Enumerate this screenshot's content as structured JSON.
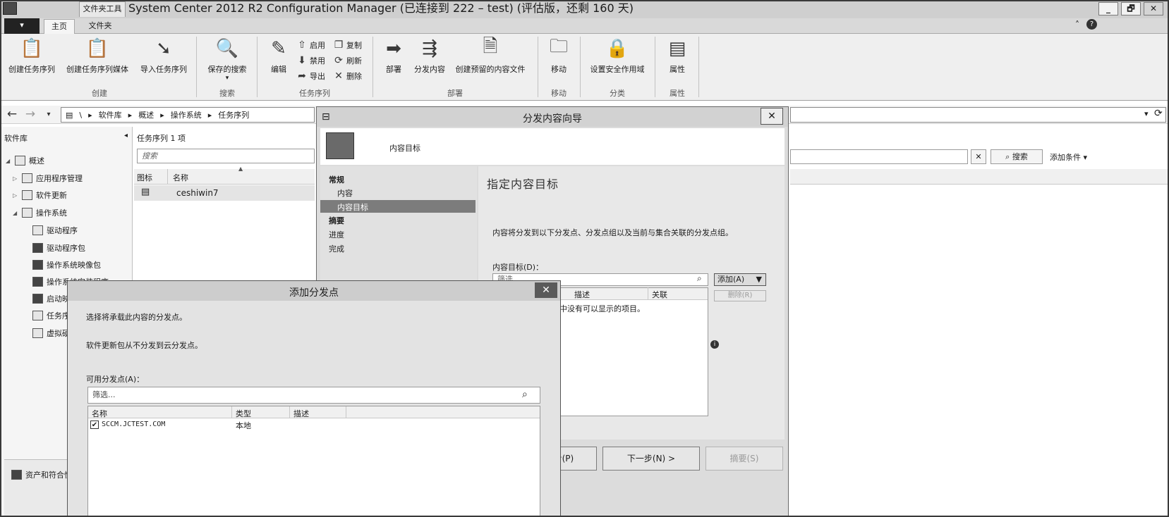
{
  "window": {
    "context_tab": "文件夹工具",
    "title": "System Center 2012 R2 Configuration Manager (已连接到 222 – test) (评估版，还剩 160 天)",
    "buttons": [
      "_",
      "🗗",
      "✕"
    ]
  },
  "ribbon_tabs": {
    "file": "",
    "home": "主页",
    "folder": "文件夹"
  },
  "ribbon": {
    "create_ts": "创建任务序列",
    "create_ts_media": "创建任务序列媒体",
    "import_ts": "导入任务序列",
    "saved_search": "保存的搜索",
    "saved_search_arrow": "▾",
    "edit": "编辑",
    "enable": "启用",
    "disable": "禁用",
    "export": "导出",
    "copy": "复制",
    "refresh": "刷新",
    "delete": "删除",
    "deploy": "部署",
    "distribute_content": "分发内容",
    "create_prestaged": "创建预留的内容文件",
    "move": "移动",
    "set_security_scope": "设置安全作用域",
    "properties": "属性",
    "groups": {
      "create": "创建",
      "search": "搜索",
      "task_sequence": "任务序列",
      "deploy": "部署",
      "move": "移动",
      "classify": "分类",
      "properties": "属性"
    }
  },
  "address": {
    "root": "\\",
    "crumbs": [
      "软件库",
      "概述",
      "操作系统",
      "任务序列"
    ]
  },
  "left_nav": {
    "header": "软件库",
    "items": [
      "概述",
      "应用程序管理",
      "软件更新",
      "操作系统",
      "驱动程序",
      "驱动程序包",
      "操作系统映像包",
      "操作系统安装程序",
      "启动映像",
      "任务序列",
      "虚拟硬盘"
    ],
    "bottom": "资产和符合性"
  },
  "center": {
    "header": "任务序列 1 项",
    "search_placeholder": "搜索",
    "col_icon": "图标",
    "col_name": "名称",
    "row_name": "ceshiwin7"
  },
  "right": {
    "search_button": "搜索",
    "add_criteria": "添加条件 ▾"
  },
  "wizard": {
    "title": "分发内容向导",
    "header": "内容目标",
    "nav": {
      "general": "常规",
      "content": "内容",
      "content_dest": "内容目标",
      "summary": "摘要",
      "progress": "进度",
      "complete": "完成"
    },
    "heading": "指定内容目标",
    "description": "内容将分发到以下分发点、分发点组以及当前与集合关联的分发点组。",
    "dest_label": "内容目标(D)：",
    "filter_text": "筛选",
    "add_button": "添加(A)",
    "remove_button": "删除(R)",
    "col_describe": "描述",
    "col_assoc": "关联",
    "empty_text": "此视图中没有可以显示的项目。",
    "prev_button": "< 上一步(P)",
    "next_button": "下一步(N) >",
    "summary_button": "摘要(S)"
  },
  "add_dp": {
    "title": "添加分发点",
    "line1": "选择将承载此内容的分发点。",
    "line2": "软件更新包从不分发到云分发点。",
    "available_label": "可用分发点(A)：",
    "filter_placeholder": "筛选...",
    "col_name": "名称",
    "col_type": "类型",
    "col_desc": "描述",
    "row_name": "SCCM.JCTEST.COM",
    "row_type": "本地",
    "row_checked": true
  }
}
